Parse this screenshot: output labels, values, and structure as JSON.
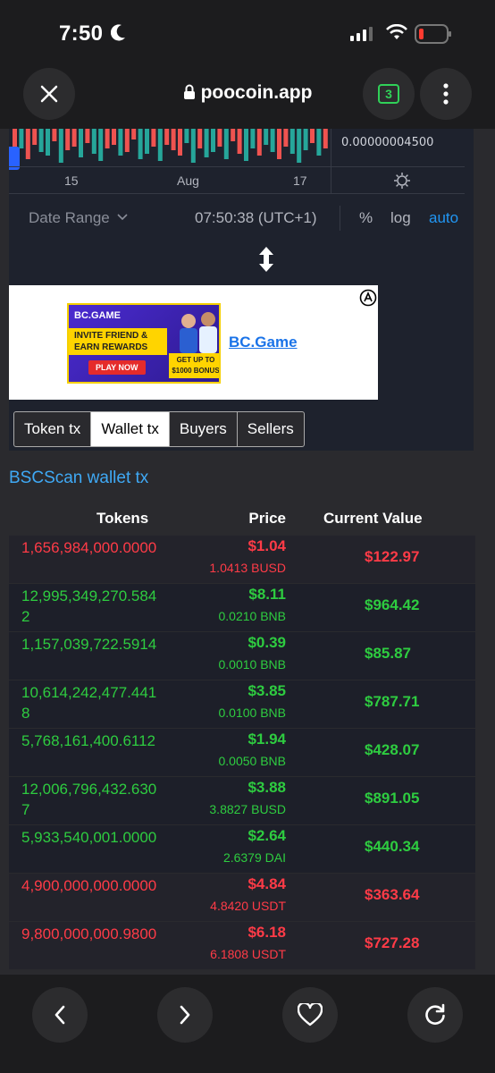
{
  "status": {
    "time": "7:50"
  },
  "browser": {
    "url": "poocoin.app",
    "tab_count": "3"
  },
  "chart": {
    "price_label": "0.00000004500",
    "ticks": [
      "15",
      "Aug",
      "17"
    ],
    "date_range": "Date Range",
    "clock": "07:50:38 (UTC+1)",
    "pct": "%",
    "log": "log",
    "auto": "auto"
  },
  "ad": {
    "link": "BC.Game",
    "logo": "BC.GAME",
    "headline": "INVITE FRIEND & EARN REWARDS",
    "cta": "PLAY NOW",
    "bonus": "GET UP TO $1000 BONUS"
  },
  "tabs": [
    "Token tx",
    "Wallet tx",
    "Buyers",
    "Sellers"
  ],
  "bsc_link": "BSCScan wallet tx",
  "table": {
    "headers": {
      "tokens": "Tokens",
      "price": "Price",
      "value": "Current Value"
    },
    "rows": [
      {
        "tokens": "1,656,984,000.0000",
        "price": "$1.04",
        "sub": "1.0413 BUSD",
        "value": "$122.97",
        "side": "sell"
      },
      {
        "tokens": "12,995,349,270.5842",
        "price": "$8.11",
        "sub": "0.0210 BNB",
        "value": "$964.42",
        "side": "buy"
      },
      {
        "tokens": "1,157,039,722.5914",
        "price": "$0.39",
        "sub": "0.0010 BNB",
        "value": "$85.87",
        "side": "buy"
      },
      {
        "tokens": "10,614,242,477.4418",
        "price": "$3.85",
        "sub": "0.0100 BNB",
        "value": "$787.71",
        "side": "buy"
      },
      {
        "tokens": "5,768,161,400.6112",
        "price": "$1.94",
        "sub": "0.0050 BNB",
        "value": "$428.07",
        "side": "buy"
      },
      {
        "tokens": "12,006,796,432.6307",
        "price": "$3.88",
        "sub": "3.8827 BUSD",
        "value": "$891.05",
        "side": "buy"
      },
      {
        "tokens": "5,933,540,001.0000",
        "price": "$2.64",
        "sub": "2.6379 DAI",
        "value": "$440.34",
        "side": "buy"
      },
      {
        "tokens": "4,900,000,000.0000",
        "price": "$4.84",
        "sub": "4.8420 USDT",
        "value": "$363.64",
        "side": "sell"
      },
      {
        "tokens": "9,800,000,000.9800",
        "price": "$6.18",
        "sub": "6.1808 USDT",
        "value": "$727.28",
        "side": "sell"
      }
    ]
  },
  "colors": {
    "buy": "#2ecc40",
    "sell": "#ff3b47",
    "link": "#3fa9f5",
    "auto": "#2196f3"
  }
}
